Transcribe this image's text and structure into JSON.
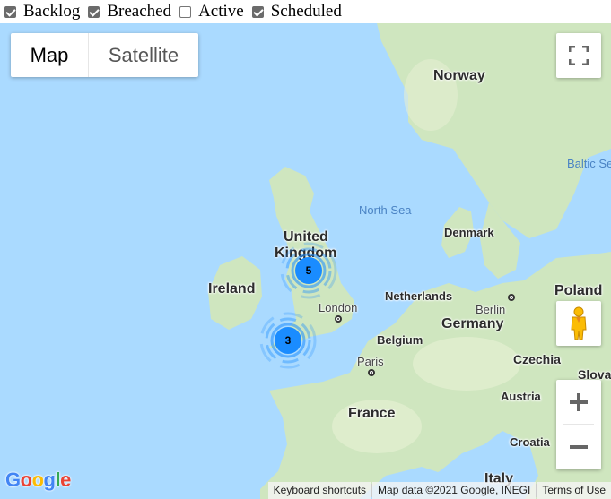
{
  "filters": [
    {
      "label": "Backlog",
      "checked": true
    },
    {
      "label": "Breached",
      "checked": true
    },
    {
      "label": "Active",
      "checked": false
    },
    {
      "label": "Scheduled",
      "checked": true
    }
  ],
  "map_type": {
    "options": [
      "Map",
      "Satellite"
    ],
    "selected": "Map"
  },
  "controls": {
    "fullscreen_icon": "fullscreen-icon",
    "pegman_icon": "street-view-pegman-icon",
    "zoom_in_label": "+",
    "zoom_out_label": "−"
  },
  "labels": {
    "countries": [
      "Norway",
      "United",
      "Kingdom",
      "Ireland",
      "Denmark",
      "Netherlands",
      "Germany",
      "Belgium",
      "France",
      "Poland",
      "Czechia",
      "Slovak",
      "Austria",
      "Croatia",
      "Italy"
    ],
    "cities": [
      "London",
      "Paris",
      "Berlin"
    ],
    "seas": [
      "North Sea",
      "Baltic Se"
    ]
  },
  "clusters": [
    {
      "count": "5",
      "color": "#1a8cff"
    },
    {
      "count": "3",
      "color": "#1a8cff"
    }
  ],
  "footer": {
    "logo": [
      "G",
      "o",
      "o",
      "g",
      "l",
      "e"
    ],
    "logo_colors": [
      "#4285f4",
      "#ea4335",
      "#fbbc05",
      "#4285f4",
      "#34a853",
      "#ea4335"
    ],
    "keyboard_shortcuts": "Keyboard shortcuts",
    "map_data": "Map data ©2021 Google, INEGI",
    "terms": "Terms of Use"
  },
  "colors": {
    "water": "#aadaff",
    "land": "#cfe6bf",
    "land_light": "#e4efd2"
  }
}
